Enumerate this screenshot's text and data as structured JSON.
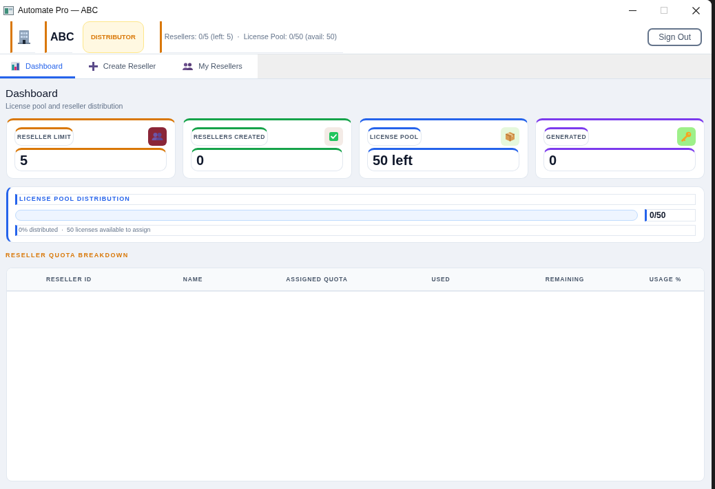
{
  "window": {
    "title": "Automate Pro — ABC",
    "controls": [
      {
        "kind": "minimize",
        "disabled": false
      },
      {
        "kind": "maximize",
        "disabled": true
      },
      {
        "kind": "close",
        "disabled": false
      }
    ]
  },
  "header": {
    "org": "ABC",
    "role_badge": "DISTRIBUTOR",
    "summary": "Resellers: 0/5 (left: 5)  ·  License Pool: 0/50 (avail: 50)",
    "sign_out": "Sign Out"
  },
  "tabs": [
    {
      "label": "Dashboard",
      "selected": true
    },
    {
      "label": "Create Reseller",
      "selected": false
    },
    {
      "label": "My Resellers",
      "selected": false
    }
  ],
  "page": {
    "title": "Dashboard",
    "subtitle": "License pool and reseller distribution"
  },
  "stats": [
    {
      "label": "RESELLER LIMIT",
      "value": "5",
      "color": "#d97706"
    },
    {
      "label": "RESELLERS CREATED",
      "value": "0",
      "color": "#16a34a"
    },
    {
      "label": "LICENSE POOL",
      "value": "50 left",
      "color": "#2563eb"
    },
    {
      "label": "GENERATED",
      "value": "0",
      "color": "#7c3aed"
    }
  ],
  "distribution": {
    "title": "LICENSE POOL DISTRIBUTION",
    "level": 0,
    "count": "0/50",
    "caption": "0% distributed  ·  50 licenses available to assign"
  },
  "breakdown": {
    "title": "RESELLER QUOTA BREAKDOWN",
    "columns": [
      "RESELLER ID",
      "NAME",
      "ASSIGNED QUOTA",
      "USED",
      "REMAINING",
      "USAGE %"
    ]
  }
}
